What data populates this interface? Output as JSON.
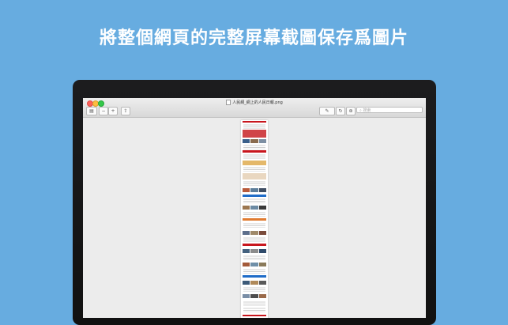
{
  "headline": "將整個網頁的完整屏幕截圖保存爲圖片",
  "window": {
    "title": "人民網_網上的人民日報.png",
    "search_placeholder": "搜索"
  },
  "toolbar": {
    "sidebar_icon": "sidebar-toggle-icon",
    "zoom_out_icon": "zoom-out-icon",
    "zoom_in_icon": "zoom-in-icon",
    "share_icon": "share-icon",
    "markup_icon": "pencil-icon",
    "rotate_icon": "rotate-icon",
    "annotate_icon": "markup-toolbox-icon",
    "search_icon": "magnifier-icon"
  },
  "colors": {
    "background": "#67ace0",
    "accent_red": "#c8161d",
    "link_blue": "#1f6cc8"
  }
}
